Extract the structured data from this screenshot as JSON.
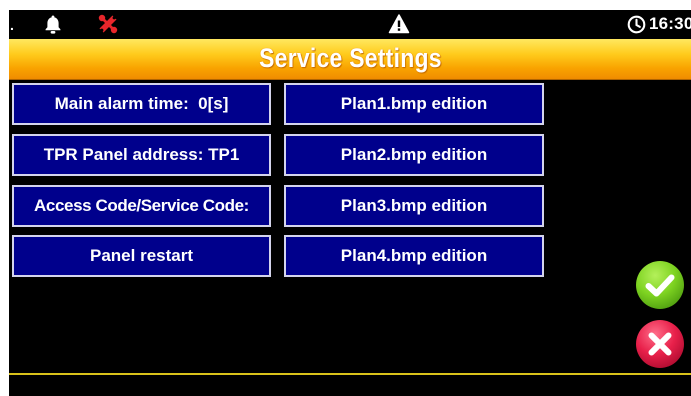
{
  "status_bar": {
    "dot": ".",
    "time": "16:30",
    "icons": [
      "bell-icon",
      "wrench-icon",
      "warning-icon",
      "clock-icon"
    ]
  },
  "title": "Service Settings",
  "left_buttons": [
    "Main alarm time:  0[s]",
    "TPR Panel address: TP1",
    "Access Code/Service Code:",
    "Panel restart"
  ],
  "right_buttons": [
    "Plan1.bmp edition",
    "Plan2.bmp edition",
    "Plan3.bmp edition",
    "Plan4.bmp edition"
  ],
  "actions": {
    "confirm_icon": "checkmark-icon",
    "cancel_icon": "close-icon"
  },
  "colors": {
    "button_fill": "#00008c",
    "button_border": "#d4d4ec",
    "title_gradient_top": "#ffe860",
    "title_gradient_bottom": "#f08c00",
    "confirm_green": "#7ed321",
    "cancel_red": "#e8204a",
    "wrench_red": "#e8262b"
  }
}
